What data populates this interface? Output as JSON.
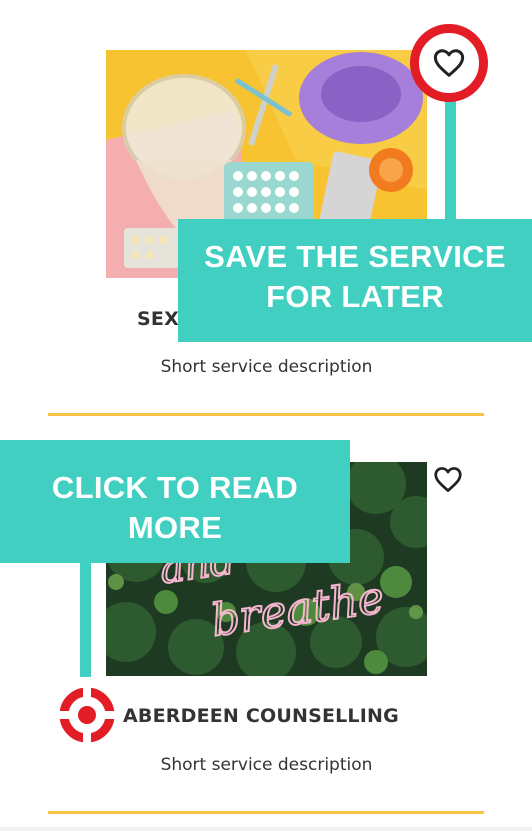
{
  "cards": [
    {
      "image_desc": "contraception-products-image",
      "title": "SEX",
      "description": "Short service description"
    },
    {
      "image_desc": "neon-sign-plants-image",
      "neon_text_line1": "and",
      "neon_text_line2": "breathe",
      "title": "ABERDEEN COUNSELLING",
      "description": "Short service description"
    }
  ],
  "callouts": {
    "save": "SAVE THE SERVICE FOR LATER",
    "read_more": "CLICK TO READ MORE"
  },
  "icons": {
    "favorite": "heart-outline-icon",
    "target": "target-icon"
  },
  "colors": {
    "accent_teal": "#40cfc1",
    "highlight_red": "#e31d25",
    "divider_yellow": "#f6c343"
  }
}
